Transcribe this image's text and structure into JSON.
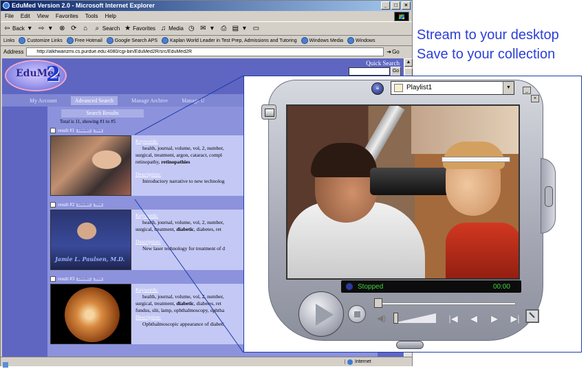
{
  "browser": {
    "title": "EduMed Version 2.0 - Microsoft Internet Explorer",
    "menu": [
      "File",
      "Edit",
      "View",
      "Favorites",
      "Tools",
      "Help"
    ],
    "toolbar": {
      "back": "Back",
      "search": "Search",
      "favorites": "Favorites",
      "media": "Media"
    },
    "links_label": "Links",
    "links": [
      "Customize Links",
      "Free Hotmail",
      "Google Search APS",
      "Kaplan World Leader in Test Prep, Admissions and Tutoring",
      "Windows Media",
      "Windows"
    ],
    "address_label": "Address",
    "address": "http://alkhwarizmi.cs.purdue.edu:4080/cgi-bin/EduMed2R/src/EduMed2R",
    "go_label": "Go",
    "status_zone": "Internet"
  },
  "page": {
    "logo_text": "EduMed",
    "logo_num": "2",
    "quick_search_label": "Quick Search",
    "quick_search_go": "Go",
    "nav": [
      "My Account",
      "Advanced Search",
      "Manage Archive",
      "Manage U"
    ],
    "search_results_label": "Search Results",
    "total_text": "Total is 11, showing #1 to #5",
    "result_btns": [
      "Unselect",
      "View"
    ],
    "keywords_label": "Keywords:",
    "description_label": "Description:",
    "results": [
      {
        "title": "result #1",
        "kw1": "health, journal, volume, vol, 2, number,",
        "kw2": "surgical, treatment, argon, cataract, compl",
        "kw3a": "retinopathy, ",
        "kw3b": "retinopathies",
        "desc": "Introductory narrative to new technolog"
      },
      {
        "title": "result #2",
        "kw1": "health, journal, volume, vol, 2, number,",
        "kw2a": "surgical, treatment, ",
        "kw2b": "diabetic",
        "kw2c": ", diabetes, ret",
        "desc": "New laser technology for treatment of d",
        "thumb_caption": "Jamie L. Paulsen, M.D."
      },
      {
        "title": "result #3",
        "kw1": "health, journal, volume, vol, 2, number,",
        "kw2a": "surgical, treatment, ",
        "kw2b": "diabetic",
        "kw2c": ", diabetes, ret",
        "kw3": "fundus, slit, lamp, ophthalmoscopy, ophtha",
        "desc": "Ophthalmoscopic appearance of diabeti"
      }
    ]
  },
  "promo": {
    "line1": "Stream to your desktop",
    "line2": "Save to your collection",
    "color": "#2b3fd8"
  },
  "player": {
    "playlist": "Playlist1",
    "status": "Stopped",
    "time": "00:00",
    "status_color": "#3fd13f",
    "volume": 0.0,
    "seek_position": 0.0
  }
}
